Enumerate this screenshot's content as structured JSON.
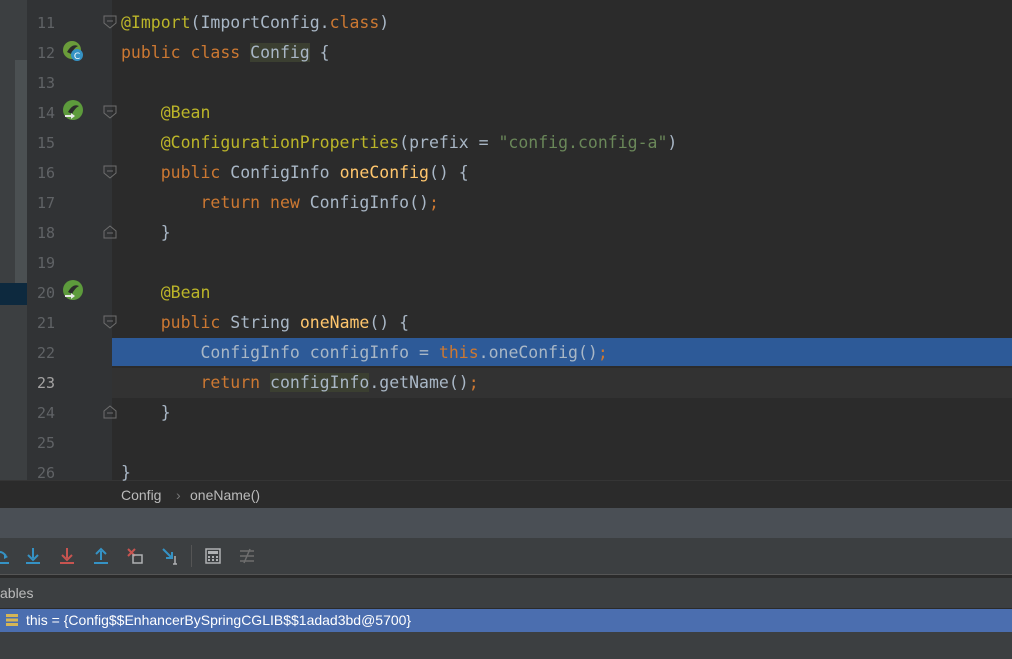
{
  "editor": {
    "lines": [
      {
        "num": "11",
        "segments": [
          {
            "t": "@Import",
            "c": "ann"
          },
          {
            "t": "(ImportConfig.",
            "c": ""
          },
          {
            "t": "class",
            "c": "kw"
          },
          {
            "t": ")",
            "c": ""
          }
        ]
      },
      {
        "num": "12",
        "segments": [
          {
            "t": "public class ",
            "c": "kw"
          },
          {
            "t": "Config",
            "c": "highlighted-class"
          },
          {
            "t": " {",
            "c": ""
          }
        ]
      },
      {
        "num": "13",
        "segments": []
      },
      {
        "num": "14",
        "segments": [
          {
            "t": "    @Bean",
            "c": "ann"
          }
        ]
      },
      {
        "num": "15",
        "segments": [
          {
            "t": "    @ConfigurationProperties",
            "c": "ann"
          },
          {
            "t": "(prefix = ",
            "c": ""
          },
          {
            "t": "\"config.config-a\"",
            "c": "str"
          },
          {
            "t": ")",
            "c": ""
          }
        ]
      },
      {
        "num": "16",
        "segments": [
          {
            "t": "    public ",
            "c": "kw"
          },
          {
            "t": "ConfigInfo ",
            "c": ""
          },
          {
            "t": "oneConfig",
            "c": "fn"
          },
          {
            "t": "() {",
            "c": ""
          }
        ]
      },
      {
        "num": "17",
        "segments": [
          {
            "t": "        return new ",
            "c": "kw"
          },
          {
            "t": "ConfigInfo()",
            "c": ""
          },
          {
            "t": ";",
            "c": "kw"
          }
        ]
      },
      {
        "num": "18",
        "segments": [
          {
            "t": "    }",
            "c": ""
          }
        ]
      },
      {
        "num": "19",
        "segments": []
      },
      {
        "num": "20",
        "segments": [
          {
            "t": "    @Bean",
            "c": "ann"
          }
        ]
      },
      {
        "num": "21",
        "segments": [
          {
            "t": "    public ",
            "c": "kw"
          },
          {
            "t": "String ",
            "c": ""
          },
          {
            "t": "oneName",
            "c": "fn"
          },
          {
            "t": "() {",
            "c": ""
          }
        ]
      },
      {
        "num": "22",
        "segments": [
          {
            "t": "        ConfigInfo configInfo = ",
            "c": ""
          },
          {
            "t": "this",
            "c": "kw"
          },
          {
            "t": ".oneConfig()",
            "c": ""
          },
          {
            "t": ";",
            "c": "kw"
          }
        ]
      },
      {
        "num": "23",
        "segments": [
          {
            "t": "        return ",
            "c": "kw"
          },
          {
            "t": "configInfo",
            "c": "highlighted-class"
          },
          {
            "t": ".getName()",
            "c": ""
          },
          {
            "t": ";",
            "c": "kw"
          }
        ]
      },
      {
        "num": "24",
        "segments": [
          {
            "t": "    }",
            "c": ""
          }
        ]
      },
      {
        "num": "25",
        "segments": []
      },
      {
        "num": "26",
        "segments": [
          {
            "t": "}",
            "c": ""
          }
        ]
      }
    ]
  },
  "breadcrumb": {
    "class_name": "Config",
    "separator": "›",
    "method_name": "oneName()"
  },
  "debug": {
    "toolbar_icons": [
      "step-over-icon",
      "step-into-icon",
      "force-step-into-icon",
      "step-out-icon",
      "drop-frame-icon",
      "run-to-cursor-icon",
      "evaluate-expression-icon",
      "trace-icon"
    ]
  },
  "variables": {
    "header": "ables",
    "row_text": "this = {Config$$EnhancerBySpringCGLIB$$1adad3bd@5700}"
  },
  "colors": {
    "execution_line": "#2d5a98",
    "selected_variable_row": "#4b6eaf",
    "annotation": "#bbb529",
    "keyword": "#cc7832",
    "string": "#6a8759",
    "method": "#ffc66d"
  }
}
